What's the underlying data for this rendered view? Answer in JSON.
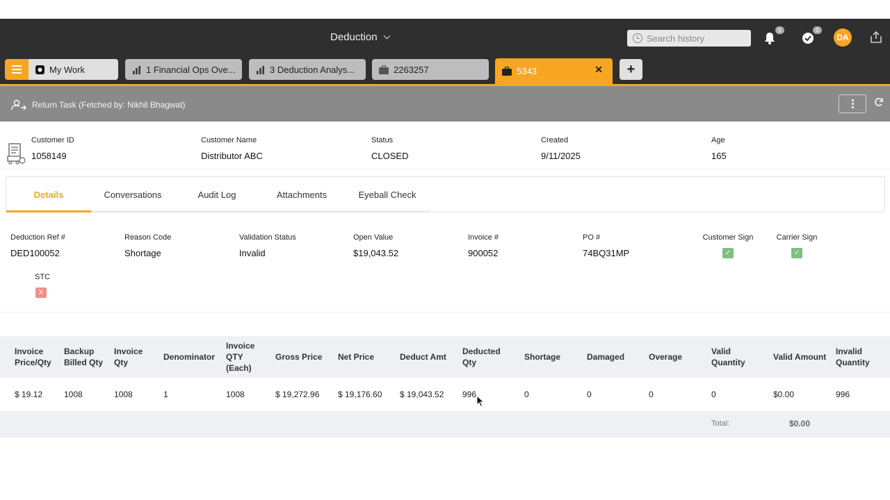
{
  "header": {
    "title": "Deduction",
    "search_placeholder": "Search history",
    "notifications_count": "0",
    "tasks_count": "0",
    "avatar_initials": "DA"
  },
  "tabs": [
    {
      "label": "My Work",
      "icon": "app-logo-icon"
    },
    {
      "label": "1 Financial Ops Ove...",
      "icon": "bar-chart-icon"
    },
    {
      "label": "3 Deduction Analys...",
      "icon": "bar-chart-icon"
    },
    {
      "label": "2263257",
      "icon": "briefcase-icon"
    },
    {
      "label": "5343",
      "icon": "briefcase-icon",
      "active": true
    }
  ],
  "taskbar": {
    "return_task_label": "Return Task (Fetched by: Nikhil Bhagwat)"
  },
  "summary": {
    "customer_id_label": "Customer ID",
    "customer_id": "1058149",
    "customer_name_label": "Customer Name",
    "customer_name": "Distributor ABC",
    "status_label": "Status",
    "status": "CLOSED",
    "created_label": "Created",
    "created": "9/11/2025",
    "age_label": "Age",
    "age": "165"
  },
  "subtabs": [
    "Details",
    "Conversations",
    "Audit Log",
    "Attachments",
    "Eyeball Check"
  ],
  "details": {
    "ref_label": "Deduction Ref #",
    "ref": "DED100052",
    "reason_label": "Reason Code",
    "reason": "Shortage",
    "validation_label": "Validation Status",
    "validation": "Invalid",
    "open_value_label": "Open Value",
    "open_value": "$19,043.52",
    "invoice_label": "Invoice #",
    "invoice": "900052",
    "po_label": "PO #",
    "po": "74BQ31MP",
    "customer_sign_label": "Customer Sign",
    "carrier_sign_label": "Carrier Sign",
    "stc_label": "STC",
    "check_mark": "✓",
    "x_mark": "X"
  },
  "table": {
    "headers": [
      "Invoice Price/Qty",
      "Backup Billed Qty",
      "Invoice Qty",
      "Denominator",
      "Invoice QTY (Each)",
      "Gross Price",
      "Net Price",
      "Deduct Amt",
      "Deducted Qty",
      "Shortage",
      "Damaged",
      "Overage",
      "Valid Quantity",
      "Valid Amount",
      "Invalid Quantity"
    ],
    "row": [
      "$ 19.12",
      "1008",
      "1008",
      "1",
      "1008",
      "$ 19,272.96",
      "$ 19,176.60",
      "$ 19,043.52",
      "996",
      "0",
      "0",
      "0",
      "0",
      "$0.00",
      "996"
    ],
    "total_label": "Total:",
    "total_value": "$0.00"
  }
}
